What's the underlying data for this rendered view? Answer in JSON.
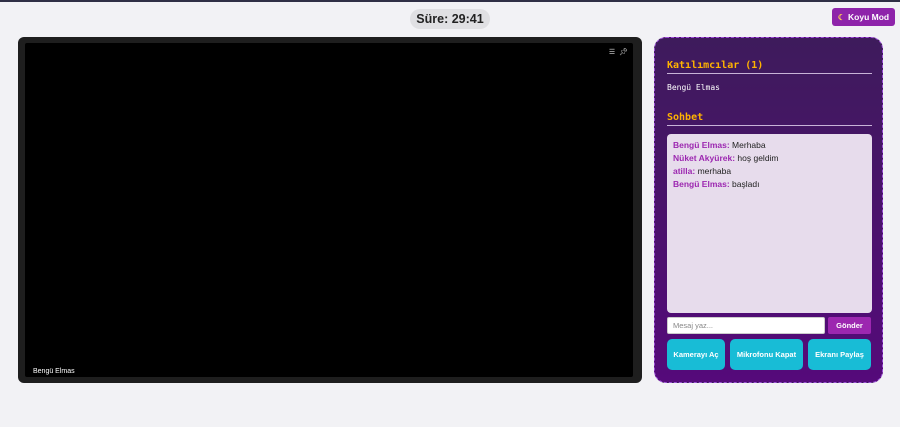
{
  "timer": {
    "label": "Süre: 29:41"
  },
  "dark_mode": {
    "icon": "moon-icon",
    "label": "Koyu Mod"
  },
  "video": {
    "participant_name": "Bengü Elmas",
    "icons": [
      "menu-icon",
      "pin-icon"
    ]
  },
  "participants": {
    "title": "Katılımcılar (1)",
    "items": [
      "Bengü Elmas"
    ]
  },
  "chat": {
    "title": "Sohbet",
    "messages": [
      {
        "user": "Bengü Elmas:",
        "text": " Merhaba"
      },
      {
        "user": "Nüket Akyürek:",
        "text": " hoş geldim"
      },
      {
        "user": "atilla:",
        "text": " merhaba"
      },
      {
        "user": "Bengü Elmas:",
        "text": " başladı"
      }
    ],
    "input_placeholder": "Mesaj yaz...",
    "send_label": "Gönder"
  },
  "controls": {
    "camera": "Kamerayı Aç",
    "mic": "Mikrofonu Kapat",
    "screen": "Ekranı Paylaş"
  },
  "colors": {
    "accent": "#9c27b0",
    "panel_bg": "#4a1470",
    "control_button": "#18bcd6",
    "heading": "#ffb300"
  }
}
